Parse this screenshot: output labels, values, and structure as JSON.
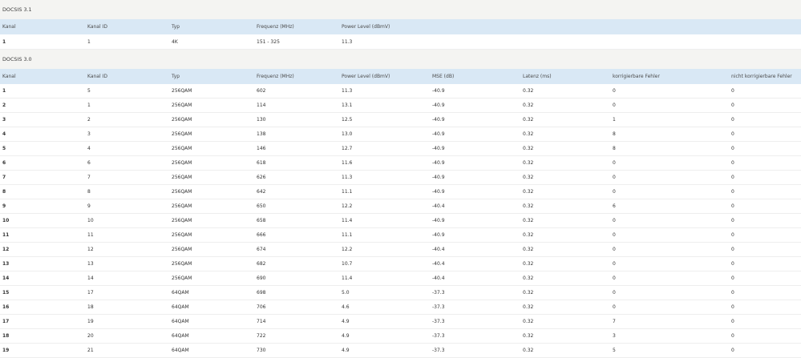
{
  "docsis31": {
    "title": "DOCSIS 3.1",
    "headers": [
      "Kanal",
      "Kanal ID",
      "Typ",
      "Frequenz (MHz)",
      "Power Level (dBmV)"
    ],
    "rows": [
      [
        "1",
        "1",
        "4K",
        "151 - 325",
        "11.3"
      ]
    ]
  },
  "docsis30": {
    "title": "DOCSIS 3.0",
    "headers": [
      "Kanal",
      "Kanal ID",
      "Typ",
      "Frequenz (MHz)",
      "Power Level (dBmV)",
      "MSE (dB)",
      "Latenz (ms)",
      "korrigierbare Fehler",
      "nicht korrigierbare Fehler"
    ],
    "rows": [
      [
        "1",
        "5",
        "256QAM",
        "602",
        "11.3",
        "-40.9",
        "0.32",
        "0",
        "0"
      ],
      [
        "2",
        "1",
        "256QAM",
        "114",
        "13.1",
        "-40.9",
        "0.32",
        "0",
        "0"
      ],
      [
        "3",
        "2",
        "256QAM",
        "130",
        "12.5",
        "-40.9",
        "0.32",
        "1",
        "0"
      ],
      [
        "4",
        "3",
        "256QAM",
        "138",
        "13.0",
        "-40.9",
        "0.32",
        "8",
        "0"
      ],
      [
        "5",
        "4",
        "256QAM",
        "146",
        "12.7",
        "-40.9",
        "0.32",
        "8",
        "0"
      ],
      [
        "6",
        "6",
        "256QAM",
        "618",
        "11.6",
        "-40.9",
        "0.32",
        "0",
        "0"
      ],
      [
        "7",
        "7",
        "256QAM",
        "626",
        "11.3",
        "-40.9",
        "0.32",
        "0",
        "0"
      ],
      [
        "8",
        "8",
        "256QAM",
        "642",
        "11.1",
        "-40.9",
        "0.32",
        "0",
        "0"
      ],
      [
        "9",
        "9",
        "256QAM",
        "650",
        "12.2",
        "-40.4",
        "0.32",
        "6",
        "0"
      ],
      [
        "10",
        "10",
        "256QAM",
        "658",
        "11.4",
        "-40.9",
        "0.32",
        "0",
        "0"
      ],
      [
        "11",
        "11",
        "256QAM",
        "666",
        "11.1",
        "-40.9",
        "0.32",
        "0",
        "0"
      ],
      [
        "12",
        "12",
        "256QAM",
        "674",
        "12.2",
        "-40.4",
        "0.32",
        "0",
        "0"
      ],
      [
        "13",
        "13",
        "256QAM",
        "682",
        "10.7",
        "-40.4",
        "0.32",
        "0",
        "0"
      ],
      [
        "14",
        "14",
        "256QAM",
        "690",
        "11.4",
        "-40.4",
        "0.32",
        "0",
        "0"
      ],
      [
        "15",
        "17",
        "64QAM",
        "698",
        "5.0",
        "-37.3",
        "0.32",
        "0",
        "0"
      ],
      [
        "16",
        "18",
        "64QAM",
        "706",
        "4.6",
        "-37.3",
        "0.32",
        "0",
        "0"
      ],
      [
        "17",
        "19",
        "64QAM",
        "714",
        "4.9",
        "-37.3",
        "0.32",
        "7",
        "0"
      ],
      [
        "18",
        "20",
        "64QAM",
        "722",
        "4.9",
        "-37.3",
        "0.32",
        "3",
        "0"
      ],
      [
        "19",
        "21",
        "64QAM",
        "730",
        "4.9",
        "-37.3",
        "0.32",
        "5",
        "0"
      ]
    ]
  }
}
